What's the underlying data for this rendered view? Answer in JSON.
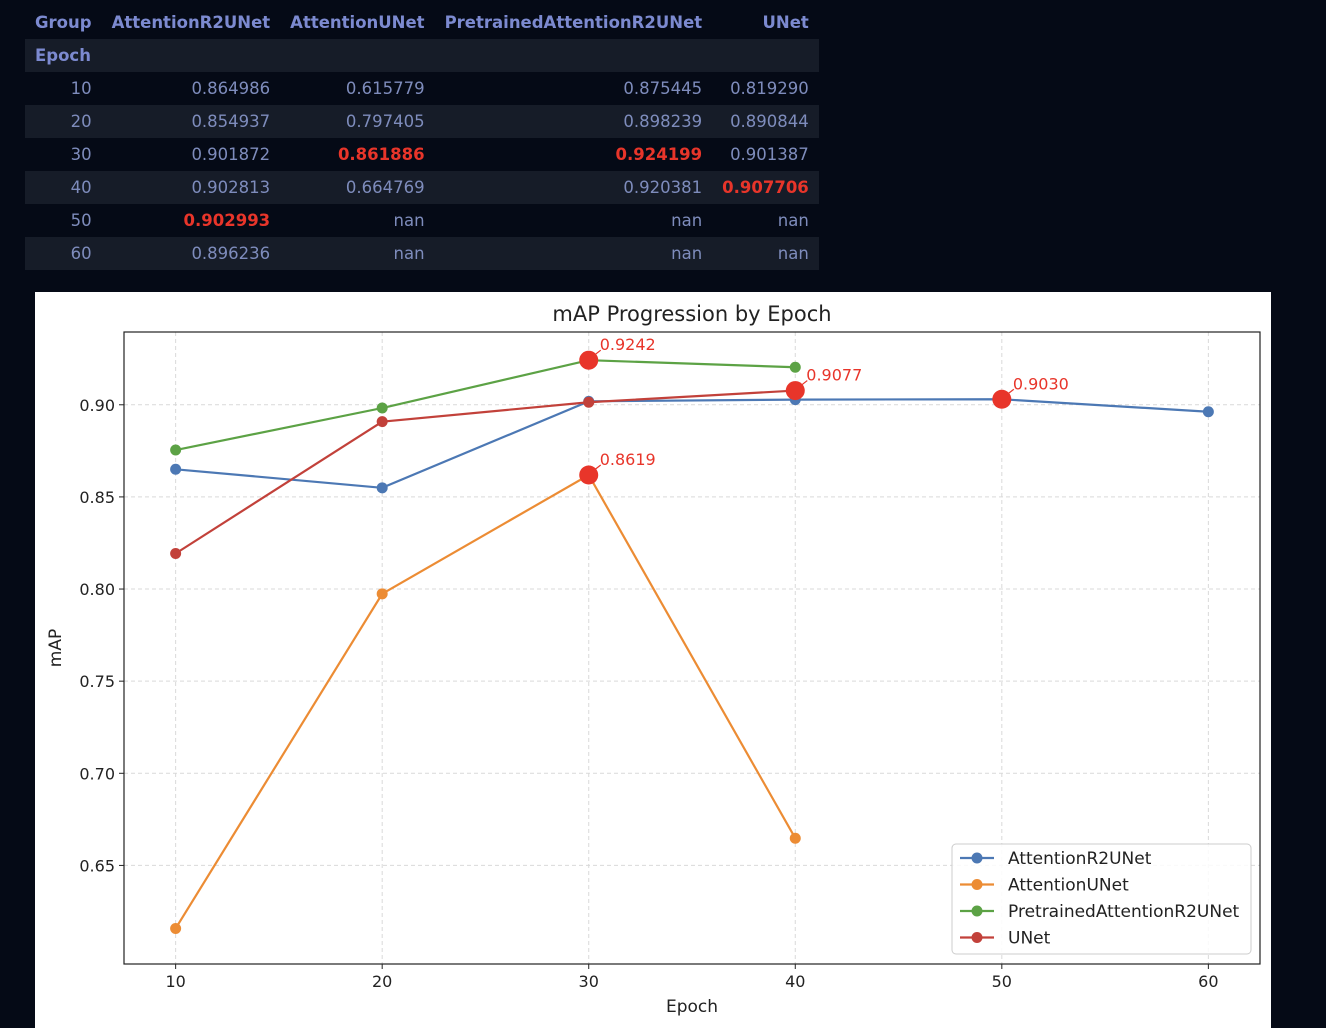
{
  "table": {
    "header_top": [
      "Group",
      "AttentionR2UNet",
      "AttentionUNet",
      "PretrainedAttentionR2UNet",
      "UNet"
    ],
    "header_index": "Epoch",
    "rows": [
      {
        "epoch": "10",
        "cells": [
          "0.864986",
          "0.615779",
          "0.875445",
          "0.819290"
        ],
        "best": []
      },
      {
        "epoch": "20",
        "cells": [
          "0.854937",
          "0.797405",
          "0.898239",
          "0.890844"
        ],
        "best": []
      },
      {
        "epoch": "30",
        "cells": [
          "0.901872",
          "0.861886",
          "0.924199",
          "0.901387"
        ],
        "best": [
          1,
          2
        ]
      },
      {
        "epoch": "40",
        "cells": [
          "0.902813",
          "0.664769",
          "0.920381",
          "0.907706"
        ],
        "best": [
          3
        ]
      },
      {
        "epoch": "50",
        "cells": [
          "0.902993",
          "nan",
          "nan",
          "nan"
        ],
        "best": [
          0
        ]
      },
      {
        "epoch": "60",
        "cells": [
          "0.896236",
          "nan",
          "nan",
          "nan"
        ],
        "best": []
      }
    ],
    "colors": {
      "header": "#7c8ad0",
      "cell": "#7e8cbc",
      "best": "#e8352a",
      "row_stripe": "#161c28",
      "background": "#050a16"
    }
  },
  "chart_data": {
    "type": "line",
    "title": "mAP Progression by Epoch",
    "xlabel": "Epoch",
    "ylabel": "mAP",
    "xlim": [
      7.5,
      62.5
    ],
    "ylim": [
      0.5965,
      0.9395
    ],
    "xticks": [
      10,
      20,
      30,
      40,
      50,
      60
    ],
    "yticks": [
      0.65,
      0.7,
      0.75,
      0.8,
      0.85,
      0.9
    ],
    "xtick_labels": [
      "10",
      "20",
      "30",
      "40",
      "50",
      "60"
    ],
    "ytick_labels": [
      "0.65",
      "0.70",
      "0.75",
      "0.80",
      "0.85",
      "0.90"
    ],
    "grid": true,
    "legend": "lower-right",
    "series": [
      {
        "name": "AttentionR2UNet",
        "color": "#4c78b4",
        "x": [
          10,
          20,
          30,
          40,
          50,
          60
        ],
        "y": [
          0.864986,
          0.854937,
          0.901872,
          0.902813,
          0.902993,
          0.896236
        ]
      },
      {
        "name": "AttentionUNet",
        "color": "#ec8c34",
        "x": [
          10,
          20,
          30,
          40
        ],
        "y": [
          0.615779,
          0.797405,
          0.861886,
          0.664769
        ]
      },
      {
        "name": "PretrainedAttentionR2UNet",
        "color": "#5ca245",
        "x": [
          10,
          20,
          30,
          40
        ],
        "y": [
          0.875445,
          0.898239,
          0.924199,
          0.920381
        ]
      },
      {
        "name": "UNet",
        "color": "#c2413a",
        "x": [
          10,
          20,
          30,
          40
        ],
        "y": [
          0.81929,
          0.890844,
          0.901387,
          0.907706
        ]
      }
    ],
    "annotations": [
      {
        "x": 30,
        "y": 0.924199,
        "label": "0.9242",
        "color": "#e8352a"
      },
      {
        "x": 40,
        "y": 0.907706,
        "label": "0.9077",
        "color": "#e8352a"
      },
      {
        "x": 50,
        "y": 0.902993,
        "label": "0.9030",
        "color": "#e8352a"
      },
      {
        "x": 30,
        "y": 0.861886,
        "label": "0.8619",
        "color": "#e8352a"
      }
    ]
  }
}
